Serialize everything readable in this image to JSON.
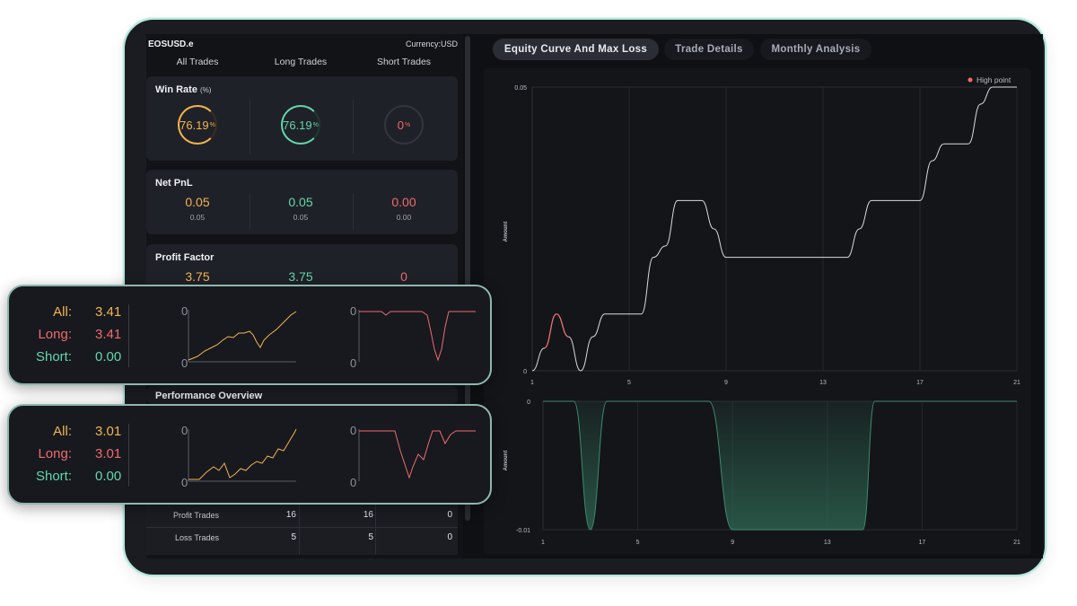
{
  "header": {
    "symbol": "EOSUSD.e",
    "currency": "Currency:USD"
  },
  "columns": [
    "All Trades",
    "Long Trades",
    "Short Trades"
  ],
  "win_rate": {
    "title": "Win Rate",
    "unit": "(%)",
    "values": [
      "76.19",
      "76.19",
      "0"
    ],
    "suffix": "%"
  },
  "net_pnl": {
    "title": "Net PnL",
    "values": [
      "0.05",
      "0.05",
      "0.00"
    ],
    "subvalues": [
      "0.05",
      "0.05",
      "0.00"
    ]
  },
  "profit_factor": {
    "title": "Profit Factor",
    "values": [
      "3.75",
      "3.75",
      "0"
    ]
  },
  "performance": {
    "title": "Performance Overview",
    "rows": [
      {
        "label": "Profit Trades",
        "values": [
          "16",
          "16",
          "0"
        ]
      },
      {
        "label": "Loss Trades",
        "values": [
          "5",
          "5",
          "0"
        ]
      }
    ]
  },
  "popups": [
    {
      "all_label": "All:",
      "all": "3.41",
      "long_label": "Long:",
      "long": "3.41",
      "short_label": "Short:",
      "short": "0.00",
      "zero_left": "0",
      "zero_left_b": "0",
      "zero_right": "0",
      "zero_right_b": "0"
    },
    {
      "all_label": "All:",
      "all": "3.01",
      "long_label": "Long:",
      "long": "3.01",
      "short_label": "Short:",
      "short": "0.00",
      "zero_left": "0",
      "zero_left_b": "0",
      "zero_right": "0",
      "zero_right_b": "0"
    }
  ],
  "tabs": [
    "Equity Curve And Max Loss",
    "Trade Details",
    "Monthly Analysis"
  ],
  "colors": {
    "orange": "#f2b451",
    "green": "#63d6a8",
    "red": "#ef6b6b",
    "accent_border": "#b6e6dc"
  },
  "chart_data": [
    {
      "type": "line",
      "ylabel": "Amount",
      "legend": "High point",
      "legend_placement": "top-right",
      "yticks": [
        "0.05",
        "0"
      ],
      "xticks": [
        "1",
        "5",
        "9",
        "13",
        "17",
        "21"
      ],
      "ylim": [
        0,
        0.05
      ],
      "x": [
        1,
        1.5,
        2,
        2.5,
        3,
        3.5,
        4,
        4.5,
        5,
        5.5,
        6,
        6.5,
        7,
        7.5,
        8,
        8.5,
        9,
        10,
        11,
        12,
        13,
        14,
        14.5,
        15,
        16,
        16.5,
        17,
        17.5,
        18,
        18.5,
        19,
        19.5,
        20,
        21
      ],
      "y": [
        0,
        0.004,
        0.01,
        0.006,
        0.0,
        0.006,
        0.01,
        0.01,
        0.01,
        0.01,
        0.02,
        0.022,
        0.03,
        0.03,
        0.03,
        0.025,
        0.02,
        0.02,
        0.02,
        0.02,
        0.02,
        0.02,
        0.025,
        0.03,
        0.03,
        0.03,
        0.03,
        0.037,
        0.04,
        0.04,
        0.04,
        0.047,
        0.05,
        0.05
      ]
    },
    {
      "type": "area",
      "ylabel": "Amount",
      "yticks": [
        "0",
        "-0.01"
      ],
      "xticks": [
        "1",
        "5",
        "9",
        "13",
        "17",
        "21"
      ],
      "ylim": [
        -0.01,
        0
      ],
      "x": [
        1,
        2,
        2.3,
        3,
        3.7,
        4,
        5,
        6,
        7,
        7.5,
        8,
        9,
        10,
        11,
        12,
        13,
        14,
        14.5,
        15,
        16,
        17,
        18,
        19,
        20,
        21
      ],
      "y": [
        0,
        0,
        0,
        -0.01,
        0,
        0,
        0,
        0,
        0,
        0,
        0,
        -0.01,
        -0.01,
        -0.01,
        -0.01,
        -0.01,
        -0.01,
        -0.01,
        0,
        0,
        0,
        0,
        0,
        0,
        0
      ]
    }
  ]
}
